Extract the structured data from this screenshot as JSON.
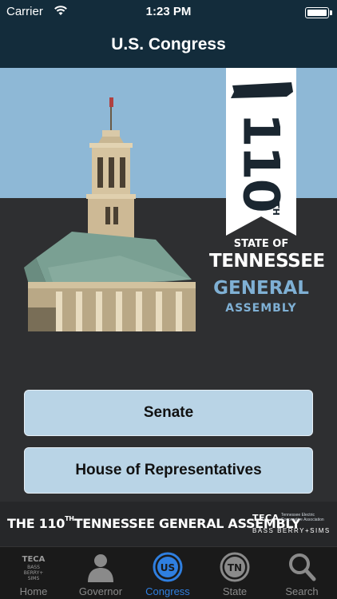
{
  "status_bar": {
    "carrier": "Carrier",
    "time": "1:23 PM"
  },
  "nav": {
    "title": "U.S. Congress"
  },
  "hero": {
    "number": "110",
    "number_suffix": "TH",
    "state_of": "STATE OF",
    "tennessee": "TENNESSEE",
    "general": "GENERAL",
    "assembly": "ASSEMBLY"
  },
  "buttons": {
    "senate": "Senate",
    "house": "House of Representatives"
  },
  "footer": {
    "lead_pre": "THE 110",
    "lead_sup": "TH",
    "lead_post": "TENNESSEE GENERAL ASSEMBLY",
    "teca": "TECA",
    "teca_sub": "Tennessee Electric Cooperative Association",
    "bbs": "BASS BERRY+SIMS"
  },
  "tabs": [
    {
      "label": "Home",
      "icon": "teca-logo-icon"
    },
    {
      "label": "Governor",
      "icon": "person-icon"
    },
    {
      "label": "Congress",
      "icon": "us-icon",
      "active": true
    },
    {
      "label": "State",
      "icon": "tn-icon"
    },
    {
      "label": "Search",
      "icon": "search-icon"
    }
  ],
  "colors": {
    "nav_bg": "#132c3b",
    "sky": "#8eb8d6",
    "button_bg": "#b9d4e6",
    "accent_active": "#2f7fe0",
    "assembly_blue": "#7fb0d4"
  }
}
